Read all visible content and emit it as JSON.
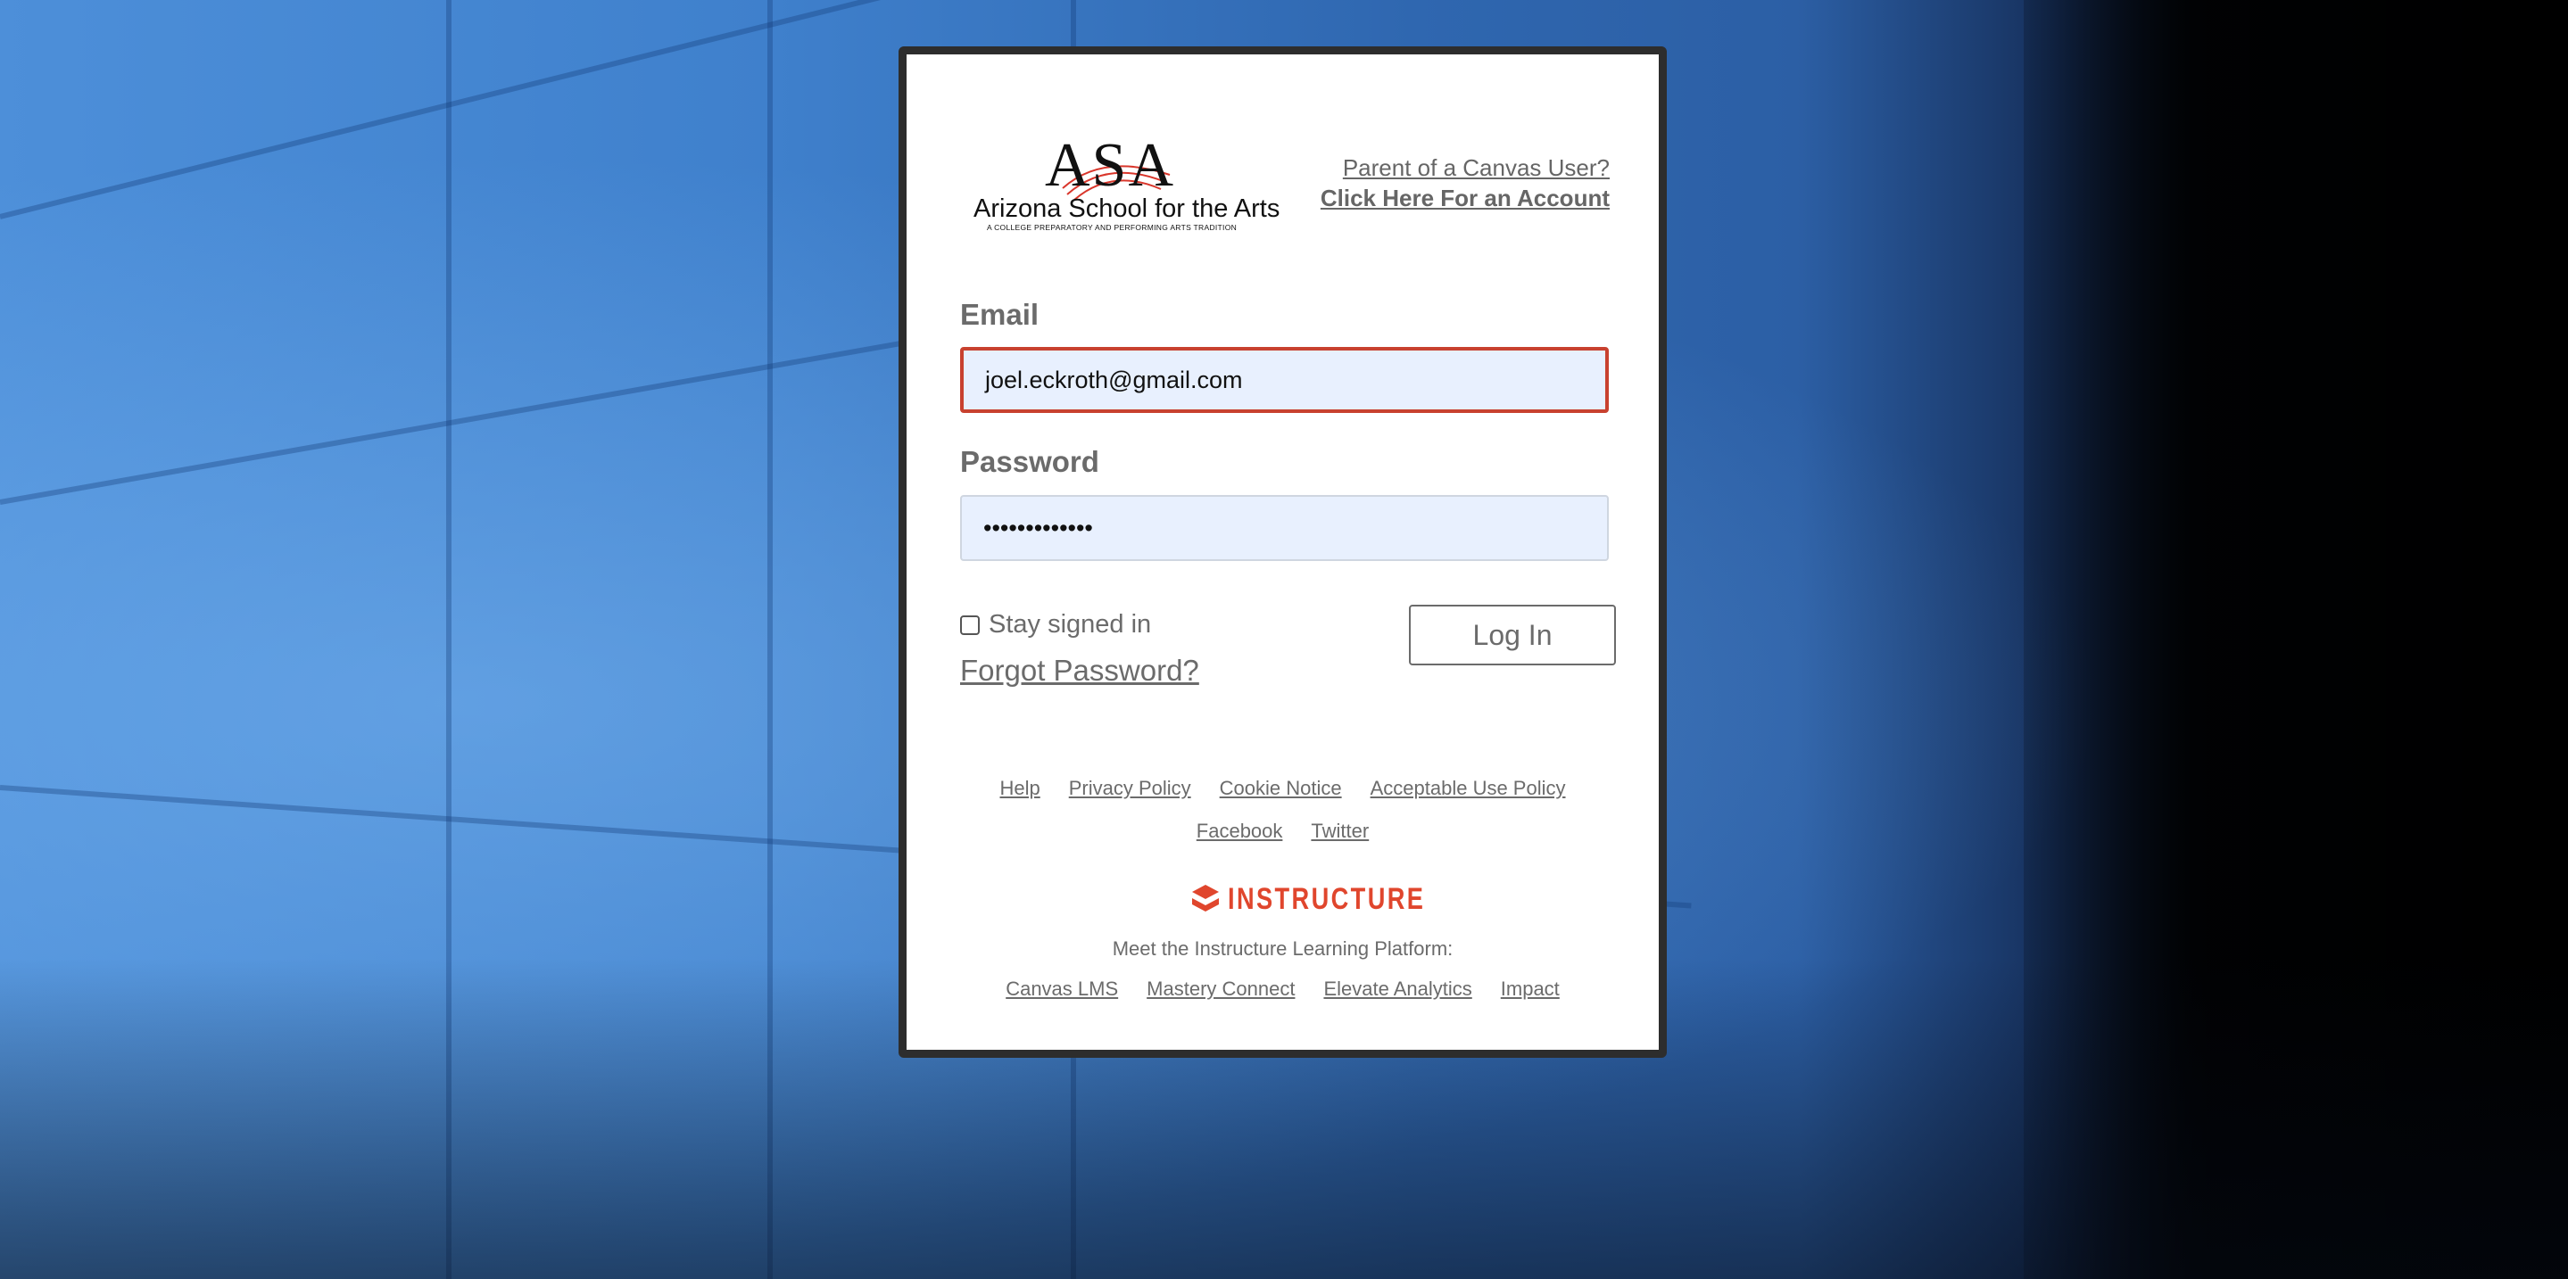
{
  "logo": {
    "mark": "ASA",
    "school_name": "Arizona School for the Arts",
    "tagline": "A COLLEGE PREPARATORY AND PERFORMING ARTS TRADITION"
  },
  "parent": {
    "question": "Parent of a Canvas User?",
    "link": "Click Here For an Account"
  },
  "form": {
    "email_label": "Email",
    "email_value": "joel.eckroth@gmail.com",
    "password_label": "Password",
    "password_value": "•••••••••••••",
    "stay_signed_in": "Stay signed in",
    "forgot_password": "Forgot Password?",
    "login_button": "Log In"
  },
  "footer": {
    "links_row1": [
      "Help",
      "Privacy Policy",
      "Cookie Notice",
      "Acceptable Use Policy"
    ],
    "links_row2": [
      "Facebook",
      "Twitter"
    ],
    "brand": "INSTRUCTURE",
    "meet_text": "Meet the Instructure Learning Platform:",
    "platform_links": [
      "Canvas LMS",
      "Mastery Connect",
      "Elevate Analytics",
      "Impact"
    ]
  },
  "colors": {
    "error_border": "#c8412f",
    "brand_red": "#e0462d",
    "field_bg": "#e8f0fe",
    "text_gray": "#6b6b6b"
  }
}
